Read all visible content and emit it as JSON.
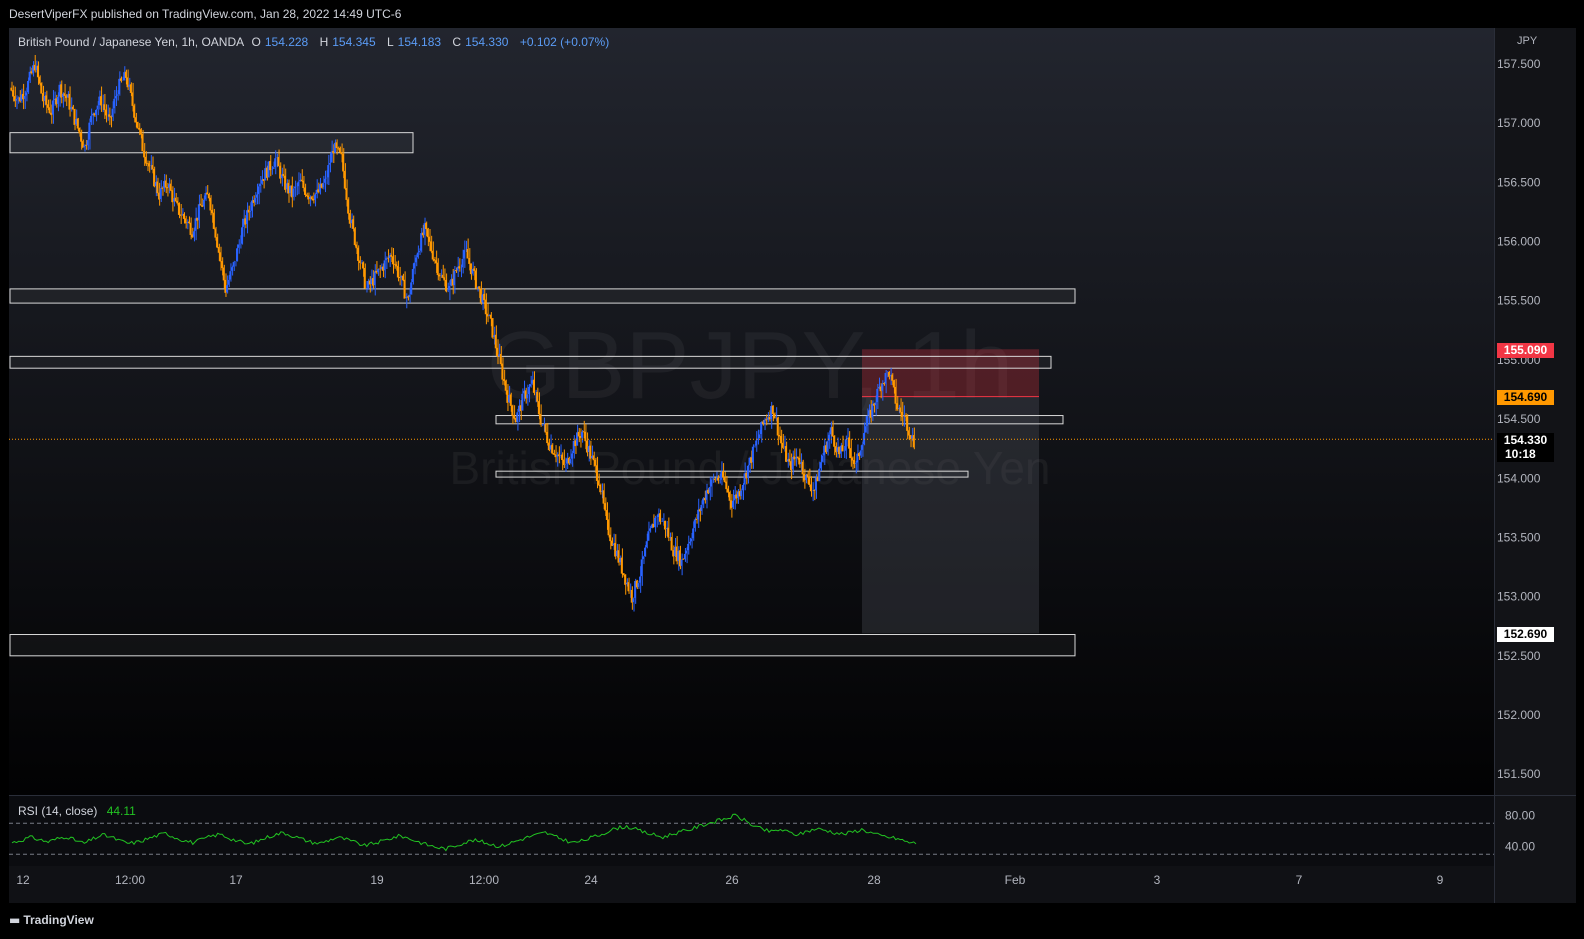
{
  "header": {
    "text": "DesertViperFX published on TradingView.com, Jan 28, 2022 14:49 UTC-6"
  },
  "footer": {
    "brand": "TradingView",
    "logo_icon": "tradingview-logo-icon"
  },
  "legend": {
    "symbol": "British Pound / Japanese Yen, 1h, OANDA",
    "o_label": "O",
    "o_value": "154.228",
    "h_label": "H",
    "h_value": "154.345",
    "l_label": "L",
    "l_value": "154.183",
    "c_label": "C",
    "c_value": "154.330",
    "change": "+0.102 (+0.07%)"
  },
  "watermark": {
    "ticker": "GBPJPY, 1h",
    "name": "British Pound / Japanese Yen"
  },
  "price_axis": {
    "currency": "JPY",
    "ticks": [
      "157.500",
      "157.000",
      "156.500",
      "156.000",
      "155.500",
      "155.000",
      "154.500",
      "154.000",
      "153.500",
      "153.000",
      "152.500",
      "152.000",
      "151.500"
    ]
  },
  "badges": {
    "stop": {
      "value": "155.090",
      "bg": "#f23645",
      "fg": "#ffffff"
    },
    "entry": {
      "value": "154.690",
      "bg": "#ff9800",
      "fg": "#000000"
    },
    "last": {
      "value": "154.330",
      "bg": "#000000",
      "fg": "#ffffff"
    },
    "countdown": "10:18",
    "target": {
      "value": "152.690",
      "bg": "#ffffff",
      "fg": "#000000"
    }
  },
  "rsi": {
    "name": "RSI (14, close)",
    "value": "44.11",
    "ticks": [
      "80.00",
      "40.00"
    ],
    "color": "#22c322"
  },
  "time_axis": {
    "ticks": [
      "12",
      "12:00",
      "17",
      "19",
      "12:00",
      "24",
      "26",
      "28",
      "Feb",
      "3",
      "7",
      "9"
    ]
  },
  "colors": {
    "up": "#2962ff",
    "down": "#ff9800",
    "grid": "#1c1f26"
  },
  "chart_data": {
    "type": "candlestick",
    "symbol": "GBPJPY",
    "timeframe": "1h",
    "y_range": [
      151.3,
      157.8
    ],
    "last_price": 154.33,
    "zones": [
      {
        "from": 156.75,
        "to": 156.92
      },
      {
        "from": 155.48,
        "to": 155.6
      },
      {
        "from": 154.93,
        "to": 155.03
      },
      {
        "from": 154.46,
        "to": 154.53
      },
      {
        "from": 154.01,
        "to": 154.06
      },
      {
        "from": 152.5,
        "to": 152.68
      }
    ],
    "short_position": {
      "entry": 154.69,
      "stop": 155.09,
      "target": 152.69
    },
    "close_path": [
      157.3,
      157.2,
      157.3,
      157.5,
      157.2,
      157.1,
      157.3,
      157.2,
      157.0,
      156.8,
      157.1,
      157.2,
      157.0,
      157.3,
      157.4,
      157.1,
      156.8,
      156.6,
      156.4,
      156.5,
      156.3,
      156.2,
      156.1,
      156.3,
      156.4,
      156.0,
      155.6,
      155.8,
      156.1,
      156.3,
      156.5,
      156.6,
      156.7,
      156.5,
      156.4,
      156.5,
      156.4,
      156.4,
      156.5,
      156.8,
      156.7,
      156.2,
      155.9,
      155.6,
      155.7,
      155.8,
      155.9,
      155.7,
      155.5,
      155.9,
      156.1,
      155.9,
      155.7,
      155.6,
      155.8,
      155.9,
      155.7,
      155.5,
      155.3,
      155.0,
      154.7,
      154.5,
      154.7,
      154.8,
      154.5,
      154.3,
      154.2,
      154.1,
      154.3,
      154.4,
      154.2,
      154.0,
      153.6,
      153.4,
      153.2,
      153.0,
      153.2,
      153.5,
      153.7,
      153.6,
      153.4,
      153.3,
      153.5,
      153.7,
      153.9,
      154.0,
      154.0,
      153.8,
      153.9,
      154.1,
      154.3,
      154.5,
      154.6,
      154.3,
      154.1,
      154.2,
      154.0,
      153.9,
      154.2,
      154.4,
      154.2,
      154.3,
      154.1,
      154.4,
      154.6,
      154.8,
      154.9,
      154.6,
      154.5,
      154.3
    ],
    "rsi_range": [
      20,
      100
    ],
    "rsi_levels": [
      70,
      30
    ],
    "rsi_path": [
      45,
      48,
      52,
      49,
      46,
      50,
      53,
      48,
      44,
      50,
      55,
      52,
      47,
      44,
      46,
      50,
      54,
      57,
      52,
      48,
      45,
      49,
      53,
      56,
      51,
      47,
      43,
      46,
      51,
      55,
      58,
      54,
      50,
      46,
      44,
      48,
      52,
      49,
      45,
      41,
      44,
      47,
      51,
      54,
      50,
      46,
      42,
      39,
      37,
      41,
      45,
      48,
      46,
      43,
      40,
      44,
      48,
      52,
      55,
      58,
      53,
      49,
      45,
      47,
      51,
      55,
      60,
      64,
      66,
      62,
      58,
      55,
      52,
      56,
      59,
      62,
      66,
      70,
      73,
      76,
      80,
      74,
      67,
      62,
      59,
      62,
      58,
      55,
      60,
      63,
      61,
      58,
      56,
      59,
      62,
      58,
      54,
      52,
      50,
      46,
      44
    ]
  }
}
